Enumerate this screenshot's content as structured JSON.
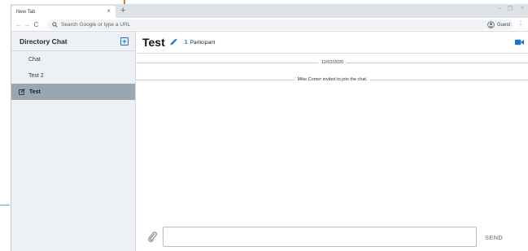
{
  "browser": {
    "tab_title": "New Tab",
    "tab_close": "×",
    "new_tab": "+",
    "window_controls": [
      "–",
      "❐",
      "×"
    ],
    "nav": {
      "back": "←",
      "forward": "→",
      "reload": "C"
    },
    "omnibox_placeholder": "Search Google or type a URL",
    "profile_label": "Guest",
    "menu": "⋮"
  },
  "sidebar": {
    "title": "Directory Chat",
    "items": [
      {
        "label": "Chat",
        "active": false
      },
      {
        "label": "Test 2",
        "active": false
      },
      {
        "label": "Test",
        "active": true
      }
    ]
  },
  "conversation": {
    "title": "Test",
    "participant_count": "1",
    "participant_label": "Participant",
    "date_separator": "12/02/2020",
    "system_message": "Mike Comer invited to join the chat."
  },
  "composer": {
    "send_label": "SEND",
    "message_value": ""
  },
  "colors": {
    "accent": "#1a73c8",
    "sidebar_bg": "#edf1f5",
    "active_item_bg": "#9aa6b0",
    "callout_orange": "#e8772e"
  }
}
